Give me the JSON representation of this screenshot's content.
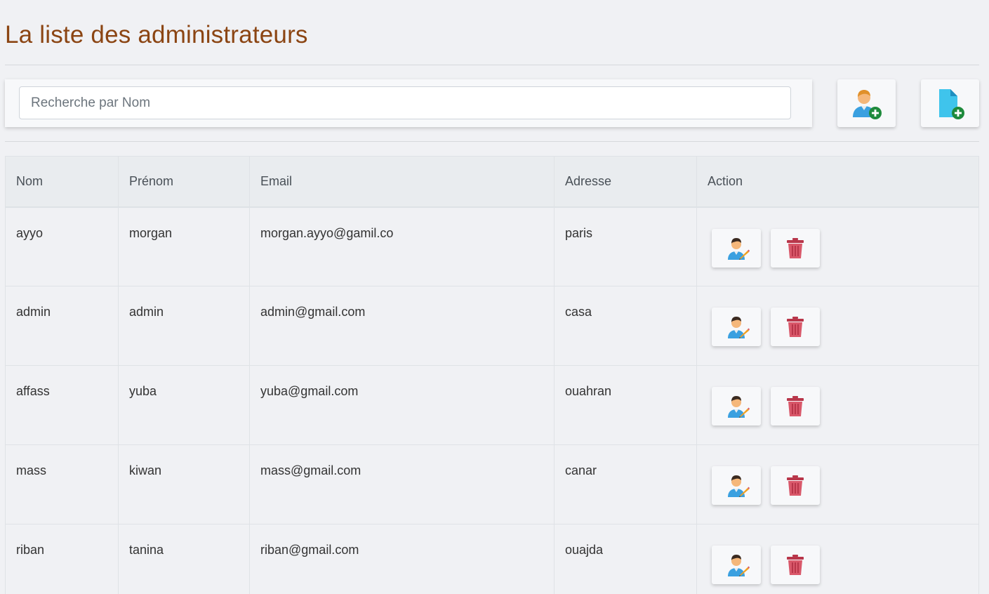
{
  "page": {
    "title": "La liste des administrateurs"
  },
  "search": {
    "placeholder": "Recherche par Nom",
    "value": ""
  },
  "toolbar": {
    "add_admin_icon": "user-add-icon",
    "add_file_icon": "file-add-icon"
  },
  "table": {
    "headers": [
      "Nom",
      "Prénom",
      "Email",
      "Adresse",
      "Action"
    ],
    "rows": [
      {
        "nom": "ayyo",
        "prenom": "morgan",
        "email": "morgan.ayyo@gamil.co",
        "adresse": "paris"
      },
      {
        "nom": "admin",
        "prenom": "admin",
        "email": "admin@gmail.com",
        "adresse": "casa"
      },
      {
        "nom": "affass",
        "prenom": "yuba",
        "email": "yuba@gmail.com",
        "adresse": "ouahran"
      },
      {
        "nom": "mass",
        "prenom": "kiwan",
        "email": "mass@gmail.com",
        "adresse": "canar"
      },
      {
        "nom": "riban",
        "prenom": "tanina",
        "email": "riban@gmail.com",
        "adresse": "ouajda"
      }
    ],
    "row_actions": {
      "edit_icon": "user-edit-icon",
      "delete_icon": "trash-icon"
    }
  },
  "colors": {
    "title": "#8b4513",
    "background": "#f0f1f4",
    "plus_badge": "#1e8a3c",
    "file_icon": "#3fc4ec",
    "trash_icon": "#d9586a"
  }
}
